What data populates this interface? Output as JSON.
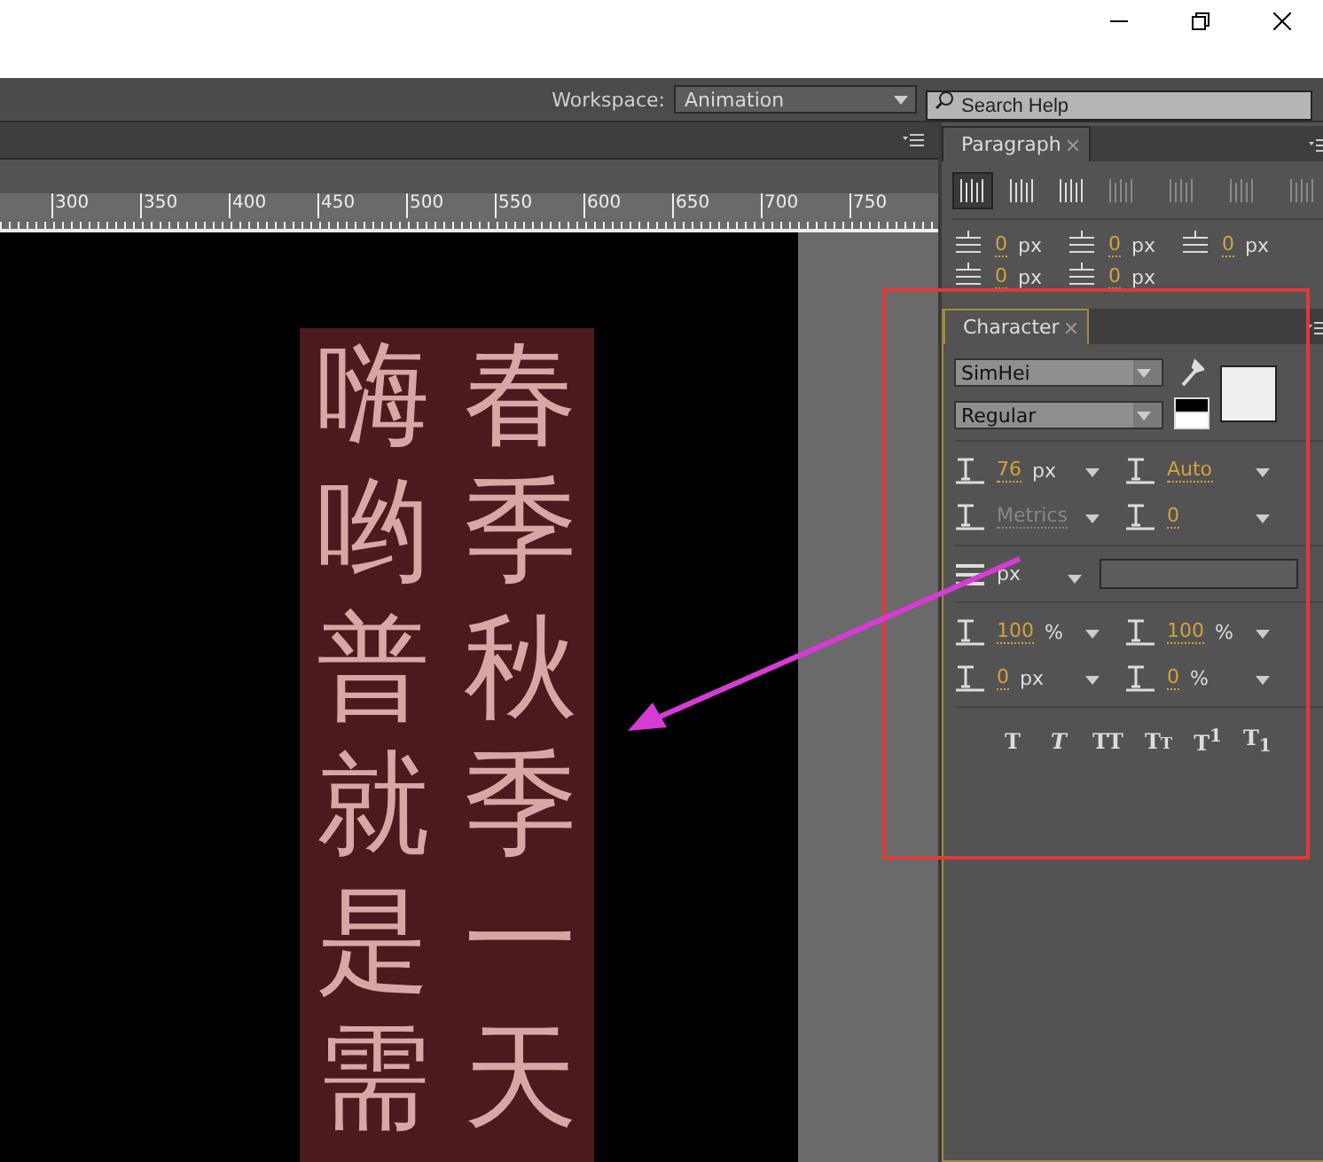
{
  "toolbar": {
    "workspace_label": "Workspace:",
    "workspace": "Animation",
    "search": {
      "placeholder": "Search Help"
    }
  },
  "ruler": {
    "labels": [
      "300",
      "350",
      "400",
      "450",
      "500",
      "550",
      "600",
      "650",
      "700",
      "750"
    ]
  },
  "stage": {
    "columns": [
      "嗨哟普就是需",
      "春季秋季一天"
    ]
  },
  "paragraph_panel": {
    "title": "Paragraph",
    "align_buttons": [
      {
        "selected": true,
        "disabled": false
      },
      {
        "selected": false,
        "disabled": false
      },
      {
        "selected": false,
        "disabled": false
      },
      {
        "selected": false,
        "disabled": true
      },
      {
        "selected": false,
        "disabled": true
      },
      {
        "selected": false,
        "disabled": true
      },
      {
        "selected": false,
        "disabled": true
      }
    ],
    "fields": [
      {
        "value": "0",
        "unit": "px"
      },
      {
        "value": "0",
        "unit": "px"
      },
      {
        "value": "0",
        "unit": "px"
      },
      {
        "value": "0",
        "unit": "px"
      },
      {
        "value": "0",
        "unit": "px"
      }
    ]
  },
  "character_panel": {
    "title": "Character",
    "font_family": "SimHei",
    "font_style": "Regular",
    "rows": [
      [
        {
          "value": "76",
          "unit": "px",
          "disabled": false
        },
        {
          "value": "Auto",
          "disabled": false
        }
      ],
      [
        {
          "value": "Metrics",
          "disabled": true
        },
        {
          "value": "0",
          "disabled": false
        }
      ]
    ],
    "line_spacing": {
      "unit": "px"
    },
    "scale_rows": [
      [
        {
          "value": "100",
          "unit": "%",
          "disabled": false
        },
        {
          "value": "100",
          "unit": "%",
          "disabled": false
        }
      ],
      [
        {
          "value": "0",
          "unit": "px",
          "disabled": false
        },
        {
          "value": "0",
          "unit": "%",
          "disabled": false
        }
      ]
    ],
    "style_buttons": [
      {
        "kind": "bold",
        "label": "T"
      },
      {
        "kind": "italic",
        "label": "T"
      },
      {
        "kind": "caps",
        "label": "TT"
      },
      {
        "kind": "smallcaps",
        "label": "TT"
      },
      {
        "kind": "super",
        "label": "T$^{1}$"
      },
      {
        "kind": "sub",
        "label": "T$_{1}$"
      }
    ]
  }
}
